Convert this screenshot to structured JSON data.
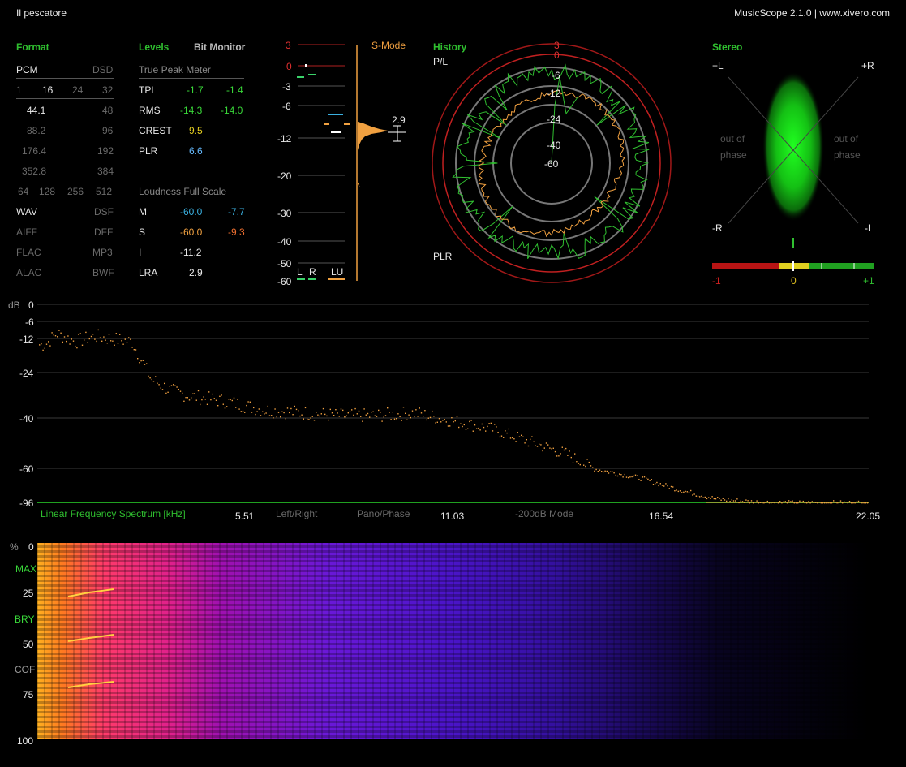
{
  "window": {
    "title": "Il pescatore",
    "app_info": "MusicScope 2.1.0 | www.xivero.com"
  },
  "format": {
    "header": "Format",
    "pcm": "PCM",
    "dsd": "DSD",
    "bits": [
      "1",
      "16",
      "24",
      "32"
    ],
    "rates": [
      [
        "44.1",
        "48"
      ],
      [
        "88.2",
        "96"
      ],
      [
        "176.4",
        "192"
      ],
      [
        "352.8",
        "384"
      ]
    ],
    "dsd_rates": [
      "64",
      "128",
      "256",
      "512"
    ],
    "files": [
      [
        "WAV",
        "DSF"
      ],
      [
        "AIFF",
        "DFF"
      ],
      [
        "FLAC",
        "MP3"
      ],
      [
        "ALAC",
        "BWF"
      ]
    ]
  },
  "levels": {
    "header": "Levels",
    "bit_monitor": "Bit Monitor",
    "true_peak_title": "True Peak Meter",
    "rows": [
      {
        "label": "TPL",
        "l": "-1.7",
        "r": "-1.4"
      },
      {
        "label": "RMS",
        "l": "-14.3",
        "r": "-14.0"
      },
      {
        "label": "CREST",
        "v": "9.5"
      },
      {
        "label": "PLR",
        "v": "6.6"
      }
    ],
    "loudness_title": "Loudness Full Scale",
    "loud_rows": [
      {
        "label": "M",
        "a": "-60.0",
        "b": "-7.7"
      },
      {
        "label": "S",
        "a": "-60.0",
        "b": "-9.3"
      },
      {
        "label": "I",
        "a": "-11.2"
      },
      {
        "label": "LRA",
        "a": "2.9"
      }
    ]
  },
  "meter": {
    "scale": [
      "3",
      "0",
      "-3",
      "-6",
      "-12",
      "-20",
      "-30",
      "-40",
      "-50",
      "-60"
    ],
    "mode": "S-Mode",
    "value": "2.9",
    "channels": [
      "L",
      "R",
      "LU"
    ]
  },
  "history": {
    "header": "History",
    "top_label": "P/L",
    "bottom_label": "PLR",
    "rings": [
      "3",
      "0",
      "-6",
      "-12",
      "-24",
      "-40",
      "-60"
    ]
  },
  "stereo": {
    "header": "Stereo",
    "plus_l": "+L",
    "plus_r": "+R",
    "minus_r": "-R",
    "minus_l": "-L",
    "out_of": "out of",
    "phase": "phase",
    "corr_min": "-1",
    "corr_mid": "0",
    "corr_max": "+1"
  },
  "spectrum": {
    "db_label": "dB",
    "y_ticks": [
      "0",
      "-6",
      "-12",
      "-24",
      "-40",
      "-60",
      "-96"
    ],
    "title": "Linear Frequency Spectrum [kHz]",
    "x_ticks": [
      "5.51",
      "11.03",
      "16.54",
      "22.05"
    ],
    "buttons": [
      "Left/Right",
      "Pano/Phase",
      "-200dB Mode"
    ]
  },
  "spectrogram": {
    "pct_label": "%",
    "y_ticks": [
      "0",
      "25",
      "50",
      "75",
      "100"
    ],
    "markers": [
      "MAX",
      "BRY",
      "COF"
    ]
  },
  "colors": {
    "accent_green": "#2fbf2f",
    "orange": "#f0a040",
    "red": "#c02020",
    "blue": "#3ab0e0"
  },
  "chart_data": [
    {
      "type": "line",
      "title": "Linear Frequency Spectrum [kHz]",
      "xlabel": "kHz",
      "ylabel": "dB",
      "xlim": [
        0,
        22.05
      ],
      "ylim": [
        -96,
        0
      ],
      "x": [
        0.2,
        0.5,
        1.0,
        1.5,
        2.0,
        2.5,
        3.0,
        3.5,
        4.0,
        5.0,
        6.0,
        7.0,
        8.0,
        9.0,
        10.0,
        11.0,
        12.0,
        13.0,
        14.0,
        15.0,
        16.0,
        17.0,
        18.0,
        19.0,
        20.0,
        22.0
      ],
      "values": [
        -14,
        -10,
        -13,
        -11,
        -12,
        -13,
        -26,
        -30,
        -32,
        -34,
        -37,
        -38,
        -39,
        -39,
        -38,
        -41,
        -44,
        -49,
        -54,
        -62,
        -70,
        -82,
        -92,
        -95,
        -96,
        -96
      ]
    }
  ]
}
